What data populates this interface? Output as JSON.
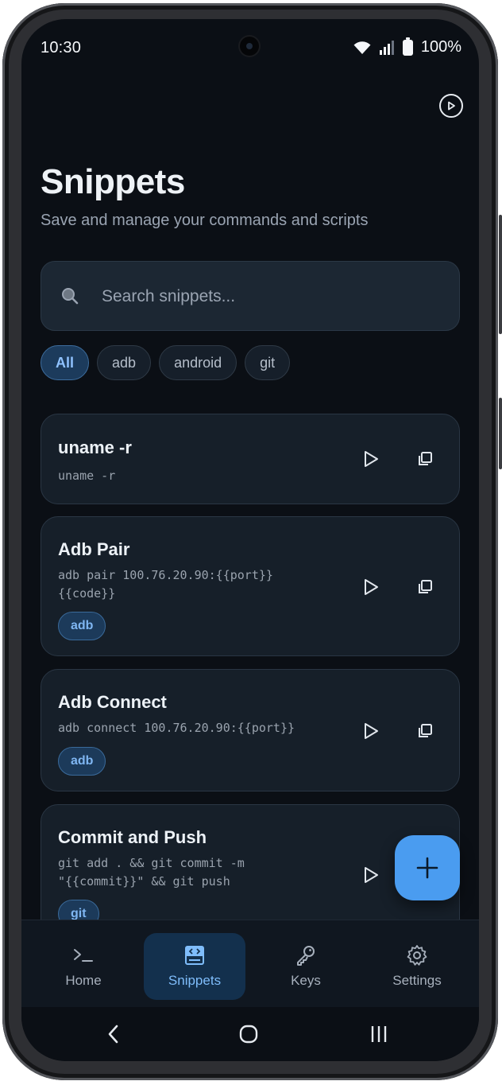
{
  "status_bar": {
    "time": "10:30",
    "battery": "100%"
  },
  "icons": {
    "play_circle": "play-circle-icon",
    "search": "search-icon",
    "play": "play-icon",
    "copy": "copy-icon",
    "add": "plus-icon",
    "home": "terminal-icon",
    "snippets": "code-file-icon",
    "keys": "key-icon",
    "settings": "gear-icon"
  },
  "header": {
    "title": "Snippets",
    "subtitle": "Save and manage your commands and scripts"
  },
  "search": {
    "placeholder": "Search snippets..."
  },
  "filters": [
    {
      "label": "All",
      "active": true
    },
    {
      "label": "adb",
      "active": false
    },
    {
      "label": "android",
      "active": false
    },
    {
      "label": "git",
      "active": false
    }
  ],
  "snippets": [
    {
      "title": "uname -r",
      "command_lines": [
        "uname -r"
      ],
      "tag": ""
    },
    {
      "title": "Adb Pair",
      "command_lines": [
        "adb pair 100.76.20.90:{{port}}",
        "{{code}}"
      ],
      "tag": "adb"
    },
    {
      "title": "Adb Connect",
      "command_lines": [
        "adb connect 100.76.20.90:{{port}}"
      ],
      "tag": "adb"
    },
    {
      "title": "Commit and Push",
      "command_lines": [
        "git add . && git commit -m",
        "\"{{commit}}\" && git push"
      ],
      "tag": "git"
    }
  ],
  "bottom_nav": [
    {
      "label": "Home",
      "active": false
    },
    {
      "label": "Snippets",
      "active": true
    },
    {
      "label": "Keys",
      "active": false
    },
    {
      "label": "Settings",
      "active": false
    }
  ],
  "colors": {
    "background": "#0b0f15",
    "card": "#161f29",
    "accent": "#4a9cf0",
    "chip_active": "#1c3b5c",
    "text_primary": "#eef2f6",
    "text_secondary": "#9aa4b2"
  }
}
